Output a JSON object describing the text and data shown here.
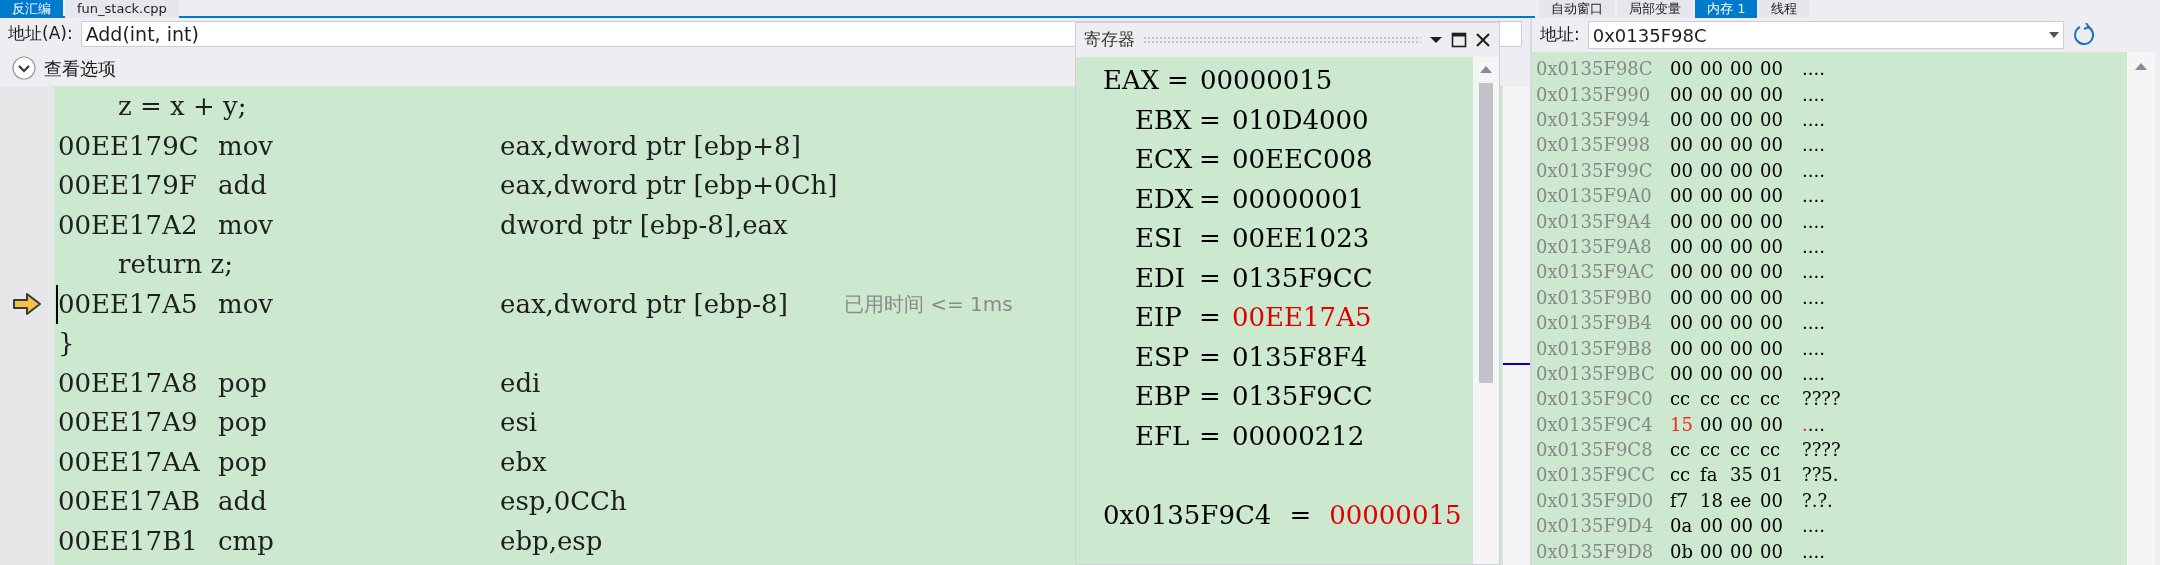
{
  "left_tabs": [
    {
      "label": "反汇编",
      "selected": true
    },
    {
      "label": "fun_stack.cpp",
      "selected": false
    }
  ],
  "disassembly": {
    "address_label": "地址(A):",
    "address_value": "Add(int, int)",
    "view_options": "查看选项",
    "lines": [
      {
        "kind": "source",
        "text": "z = x + y;"
      },
      {
        "kind": "instr",
        "address": "00EE179C",
        "mnemonic": "mov",
        "operands": "eax,dword ptr [ebp+8]",
        "current": false
      },
      {
        "kind": "instr",
        "address": "00EE179F",
        "mnemonic": "add",
        "operands": "eax,dword ptr [ebp+0Ch]",
        "current": false
      },
      {
        "kind": "instr",
        "address": "00EE17A2",
        "mnemonic": "mov",
        "operands": "dword ptr [ebp-8],eax",
        "current": false
      },
      {
        "kind": "source",
        "text": "return z;"
      },
      {
        "kind": "instr",
        "address": "00EE17A5",
        "mnemonic": "mov",
        "operands": "eax,dword ptr [ebp-8]",
        "current": true,
        "note": "已用时间 <= 1ms"
      },
      {
        "kind": "brace",
        "text": "}"
      },
      {
        "kind": "instr",
        "address": "00EE17A8",
        "mnemonic": "pop",
        "operands": "edi",
        "current": false
      },
      {
        "kind": "instr",
        "address": "00EE17A9",
        "mnemonic": "pop",
        "operands": "esi",
        "current": false
      },
      {
        "kind": "instr",
        "address": "00EE17AA",
        "mnemonic": "pop",
        "operands": "ebx",
        "current": false
      },
      {
        "kind": "instr",
        "address": "00EE17AB",
        "mnemonic": "add",
        "operands": "esp,0CCh",
        "current": false
      },
      {
        "kind": "instr",
        "address": "00EE17B1",
        "mnemonic": "cmp",
        "operands": "ebp,esp",
        "current": false
      }
    ]
  },
  "registers": {
    "title": "寄存器",
    "rows": [
      {
        "name": "EAX",
        "value": "00000015",
        "changed": false
      },
      {
        "name": "EBX",
        "value": "010D4000",
        "changed": false
      },
      {
        "name": "ECX",
        "value": "00EEC008",
        "changed": false
      },
      {
        "name": "EDX",
        "value": "00000001",
        "changed": false
      },
      {
        "name": "ESI",
        "value": "00EE1023",
        "changed": false
      },
      {
        "name": "EDI",
        "value": "0135F9CC",
        "changed": false
      },
      {
        "name": "EIP",
        "value": "00EE17A5",
        "changed": true
      },
      {
        "name": "ESP",
        "value": "0135F8F4",
        "changed": false
      },
      {
        "name": "EBP",
        "value": "0135F9CC",
        "changed": false
      },
      {
        "name": "EFL",
        "value": "00000212",
        "changed": false
      }
    ],
    "equals": "=",
    "watch": {
      "address": "0x0135F9C4",
      "equals": "=",
      "value": "00000015",
      "changed": true
    }
  },
  "right_tabs": [
    {
      "label": "自动窗口",
      "selected": false
    },
    {
      "label": "局部变量",
      "selected": false
    },
    {
      "label": "内存 1",
      "selected": true
    },
    {
      "label": "线程",
      "selected": false
    }
  ],
  "memory": {
    "address_label": "地址:",
    "address_value": "0x0135F98C",
    "rows": [
      {
        "address": "0x0135F98C",
        "bytes": [
          {
            "text": "00",
            "changed": false
          },
          {
            "text": "00",
            "changed": false
          },
          {
            "text": "00",
            "changed": false
          },
          {
            "text": "00",
            "changed": false
          }
        ],
        "ascii": "...."
      },
      {
        "address": "0x0135F990",
        "bytes": [
          {
            "text": "00",
            "changed": false
          },
          {
            "text": "00",
            "changed": false
          },
          {
            "text": "00",
            "changed": false
          },
          {
            "text": "00",
            "changed": false
          }
        ],
        "ascii": "...."
      },
      {
        "address": "0x0135F994",
        "bytes": [
          {
            "text": "00",
            "changed": false
          },
          {
            "text": "00",
            "changed": false
          },
          {
            "text": "00",
            "changed": false
          },
          {
            "text": "00",
            "changed": false
          }
        ],
        "ascii": "...."
      },
      {
        "address": "0x0135F998",
        "bytes": [
          {
            "text": "00",
            "changed": false
          },
          {
            "text": "00",
            "changed": false
          },
          {
            "text": "00",
            "changed": false
          },
          {
            "text": "00",
            "changed": false
          }
        ],
        "ascii": "...."
      },
      {
        "address": "0x0135F99C",
        "bytes": [
          {
            "text": "00",
            "changed": false
          },
          {
            "text": "00",
            "changed": false
          },
          {
            "text": "00",
            "changed": false
          },
          {
            "text": "00",
            "changed": false
          }
        ],
        "ascii": "...."
      },
      {
        "address": "0x0135F9A0",
        "bytes": [
          {
            "text": "00",
            "changed": false
          },
          {
            "text": "00",
            "changed": false
          },
          {
            "text": "00",
            "changed": false
          },
          {
            "text": "00",
            "changed": false
          }
        ],
        "ascii": "...."
      },
      {
        "address": "0x0135F9A4",
        "bytes": [
          {
            "text": "00",
            "changed": false
          },
          {
            "text": "00",
            "changed": false
          },
          {
            "text": "00",
            "changed": false
          },
          {
            "text": "00",
            "changed": false
          }
        ],
        "ascii": "...."
      },
      {
        "address": "0x0135F9A8",
        "bytes": [
          {
            "text": "00",
            "changed": false
          },
          {
            "text": "00",
            "changed": false
          },
          {
            "text": "00",
            "changed": false
          },
          {
            "text": "00",
            "changed": false
          }
        ],
        "ascii": "...."
      },
      {
        "address": "0x0135F9AC",
        "bytes": [
          {
            "text": "00",
            "changed": false
          },
          {
            "text": "00",
            "changed": false
          },
          {
            "text": "00",
            "changed": false
          },
          {
            "text": "00",
            "changed": false
          }
        ],
        "ascii": "...."
      },
      {
        "address": "0x0135F9B0",
        "bytes": [
          {
            "text": "00",
            "changed": false
          },
          {
            "text": "00",
            "changed": false
          },
          {
            "text": "00",
            "changed": false
          },
          {
            "text": "00",
            "changed": false
          }
        ],
        "ascii": "...."
      },
      {
        "address": "0x0135F9B4",
        "bytes": [
          {
            "text": "00",
            "changed": false
          },
          {
            "text": "00",
            "changed": false
          },
          {
            "text": "00",
            "changed": false
          },
          {
            "text": "00",
            "changed": false
          }
        ],
        "ascii": "...."
      },
      {
        "address": "0x0135F9B8",
        "bytes": [
          {
            "text": "00",
            "changed": false
          },
          {
            "text": "00",
            "changed": false
          },
          {
            "text": "00",
            "changed": false
          },
          {
            "text": "00",
            "changed": false
          }
        ],
        "ascii": "...."
      },
      {
        "address": "0x0135F9BC",
        "bytes": [
          {
            "text": "00",
            "changed": false
          },
          {
            "text": "00",
            "changed": false
          },
          {
            "text": "00",
            "changed": false
          },
          {
            "text": "00",
            "changed": false
          }
        ],
        "ascii": "...."
      },
      {
        "address": "0x0135F9C0",
        "bytes": [
          {
            "text": "cc",
            "changed": false
          },
          {
            "text": "cc",
            "changed": false
          },
          {
            "text": "cc",
            "changed": false
          },
          {
            "text": "cc",
            "changed": false
          }
        ],
        "ascii": "????"
      },
      {
        "address": "0x0135F9C4",
        "bytes": [
          {
            "text": "15",
            "changed": true
          },
          {
            "text": "00",
            "changed": false
          },
          {
            "text": "00",
            "changed": false
          },
          {
            "text": "00",
            "changed": false
          }
        ],
        "ascii": "...."
      },
      {
        "address": "0x0135F9C8",
        "bytes": [
          {
            "text": "cc",
            "changed": false
          },
          {
            "text": "cc",
            "changed": false
          },
          {
            "text": "cc",
            "changed": false
          },
          {
            "text": "cc",
            "changed": false
          }
        ],
        "ascii": "????"
      },
      {
        "address": "0x0135F9CC",
        "bytes": [
          {
            "text": "cc",
            "changed": false
          },
          {
            "text": "fa",
            "changed": false
          },
          {
            "text": "35",
            "changed": false
          },
          {
            "text": "01",
            "changed": false
          }
        ],
        "ascii": "??5."
      },
      {
        "address": "0x0135F9D0",
        "bytes": [
          {
            "text": "f7",
            "changed": false
          },
          {
            "text": "18",
            "changed": false
          },
          {
            "text": "ee",
            "changed": false
          },
          {
            "text": "00",
            "changed": false
          }
        ],
        "ascii": "?.?."
      },
      {
        "address": "0x0135F9D4",
        "bytes": [
          {
            "text": "0a",
            "changed": false
          },
          {
            "text": "00",
            "changed": false
          },
          {
            "text": "00",
            "changed": false
          },
          {
            "text": "00",
            "changed": false
          }
        ],
        "ascii": "...."
      },
      {
        "address": "0x0135F9D8",
        "bytes": [
          {
            "text": "0b",
            "changed": false
          },
          {
            "text": "00",
            "changed": false
          },
          {
            "text": "00",
            "changed": false
          },
          {
            "text": "00",
            "changed": false
          }
        ],
        "ascii": "...."
      }
    ]
  }
}
